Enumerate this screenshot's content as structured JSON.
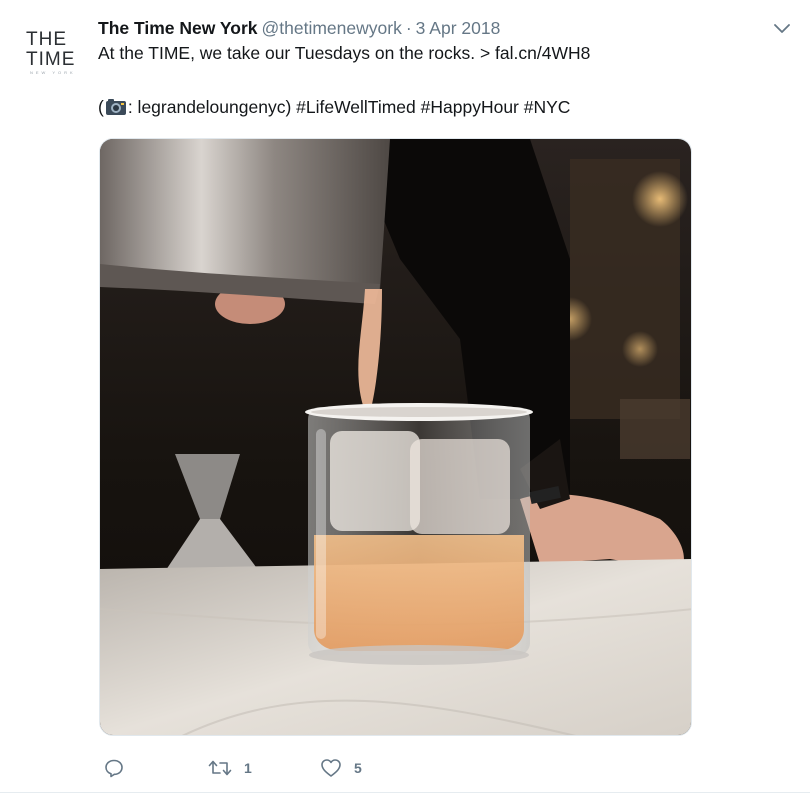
{
  "account": {
    "display_name": "The Time New York",
    "handle": "@thetimenewyork",
    "separator": "·",
    "date": "3 Apr 2018",
    "avatar": {
      "line1": "THE",
      "line2": "TIME",
      "subline": "NEW YORK"
    }
  },
  "tweet": {
    "line1": "At the TIME, we take our Tuesdays on the rocks. > fal.cn/4WH8",
    "line2_prefix": "(",
    "camera_icon": "camera-emoji-icon",
    "line2_suffix": ": legrandeloungenyc) #LifeWellTimed #HappyHour #NYC"
  },
  "media": {
    "description_icon": "photo-cocktail-pour"
  },
  "actions": {
    "reply_icon": "reply-icon",
    "retweet_icon": "retweet-icon",
    "retweet_count": "1",
    "like_icon": "heart-icon",
    "like_count": "5"
  },
  "colors": {
    "text": "#14171a",
    "secondary": "#657786",
    "border": "#e6ecf0"
  }
}
